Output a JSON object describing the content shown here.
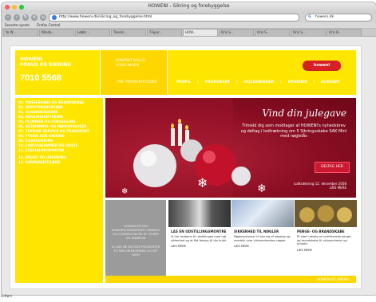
{
  "browser": {
    "title": "HOWENI - Sikring og forebyggelse",
    "url": "http://www.howeni.dk/sikring_og_forebyggelse.html",
    "search": "howeni.dk",
    "bookmarks": [
      "Seneste nyeste",
      "Firefox Central"
    ],
    "tabs": [
      "Ye W...",
      "Windo...",
      "Løbbr ...",
      "Trends...",
      "T-Spor...",
      "HOW...",
      "Oris S...",
      "Oris S...",
      "Oris S...",
      "Oris B..."
    ],
    "active_tab": 5,
    "status": "Udført"
  },
  "header": {
    "logo_line1": "HOWENI",
    "logo_line2": "FOKUS PÅ SIKRING",
    "phone": "7010 5568",
    "kontakt_line1": "KONTAKT SALGS-",
    "kontakt_line2": "AFDELINGEN",
    "brand_badge": "howeni",
    "pdf_link": "PDF PRODUKTFOLDER",
    "nav": [
      "PROFIL",
      "PRODUKTER",
      "VEJLEDNINGER",
      "NYHEDER",
      "KONTAKT"
    ]
  },
  "sidebar": {
    "items": [
      "01. PENGESKABE OG BRANDSKABE",
      "02. DEPOTSKABSSKABE",
      "03. GLASBOKSSKABE",
      "04. NØGLEHÅNDTERING",
      "05. PLOMBER OG FORSEGLING",
      "06. BETJENINGS- OG PARKERSLUSER",
      "07. TEKNISK SERVICE OG TRANSPORT",
      "08. FYSISK EDB-SIKRING",
      "09. KASSESIKRING",
      "10. FØRTOGKAMMER OG SKILTE",
      "11. SPECIALPRODUKTER"
    ],
    "items2": [
      "12. BRUGT OG UDFØRING",
      "13. KAMPAGNETILBUD"
    ]
  },
  "hero": {
    "title": "Vind din julegave",
    "text": "Tilmeld dig som modtager af HOWENI's nyhedsbrev og deltag i lodtrækning om 5 Sikringsskabe SAK Mini med nøglelås",
    "button": "DELTAG HER",
    "foot1": "Lodtrækning 12. december 2008",
    "foot2": "LÆS MERE"
  },
  "promo": {
    "grey_text1": "HOWENI ER DIN SIKKERHEDSPARTNER I SIKRING OG FOREBYGGELSE AF TYVERI OG INDBRUD",
    "grey_text2": "VI HAR DE RIGTIGE PRODUKTER TIL DIN VIRKSOMHED OG DIT HJEM",
    "columns": [
      {
        "title": "LÅS EN UDSTILLINGSMONTRE",
        "text": "Vi har skabene til udstillingen med høj sikkerhed og et flot design til din butik.",
        "more": "LÆS MERE"
      },
      {
        "title": "SIKKERHED TIL NØGLER",
        "text": "Nøglesystemer til styring af adgang og overblik over virksomhedens nøgler.",
        "more": "LÆS MERE"
      },
      {
        "title": "PENGE- OG BRANDSKABE",
        "text": "Et stort udvalg af certificerede penge- og brandskabe til virksomheder og private.",
        "more": "LÆS MERE"
      }
    ],
    "footer_link": "HOWENI ER SIKRING"
  },
  "colors": {
    "yellow": "#ffe600",
    "red": "#8b0e23",
    "grey": "#9b9b9b",
    "brand_red": "#d52026"
  }
}
